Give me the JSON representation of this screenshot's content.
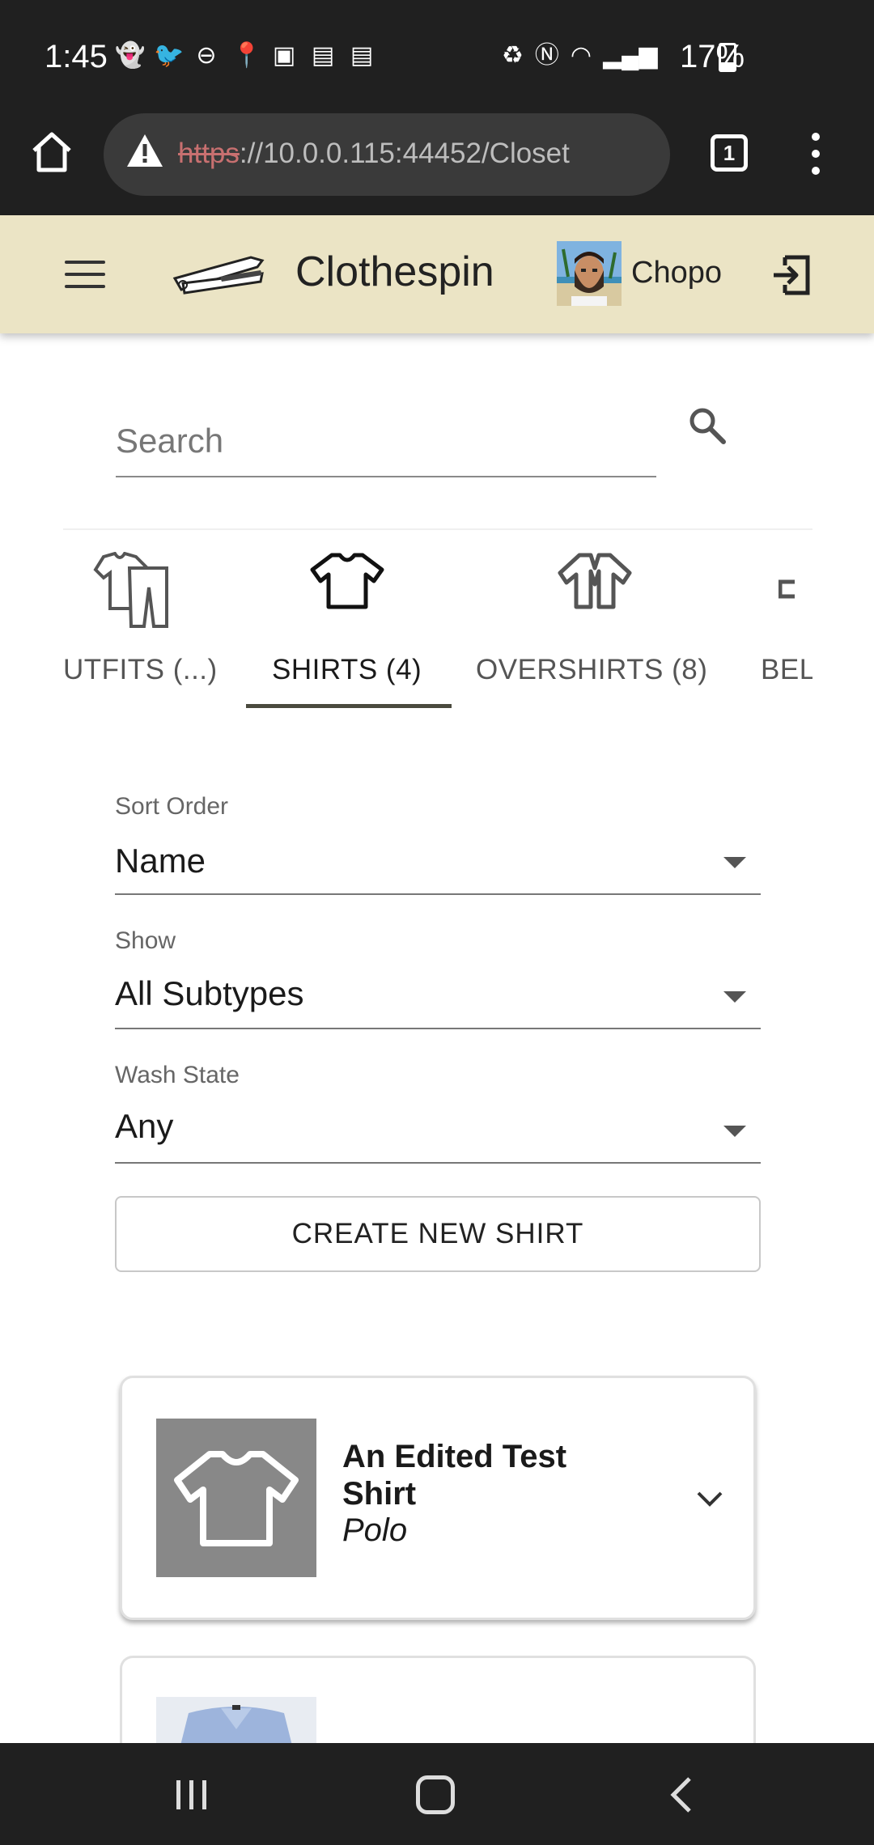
{
  "status_bar": {
    "time": "1:45",
    "battery_percent": "17%",
    "left_icons": [
      "snapchat-icon",
      "twitter-icon",
      "dnd-icon",
      "location-icon",
      "gallery-icon",
      "news-icon",
      "news-icon"
    ],
    "right_icons": [
      "battery-saver-icon",
      "nfc-icon",
      "wifi-icon",
      "signal-icon"
    ]
  },
  "browser": {
    "url_scheme": "https",
    "url_rest": "://10.0.0.115:44452/Closet",
    "tab_count": "1"
  },
  "app": {
    "brand": "Clothespin",
    "username": "Chopo",
    "header_bg": "#ebe4c5"
  },
  "search": {
    "placeholder": "Search"
  },
  "tabs": [
    {
      "label": "UTFITS (...)",
      "icon": "outfits-icon",
      "active": false
    },
    {
      "label": "SHIRTS (4)",
      "icon": "shirt-icon",
      "active": true
    },
    {
      "label": "OVERSHIRTS (8)",
      "icon": "overshirt-icon",
      "active": false
    },
    {
      "label": "BEL",
      "icon": "belt-icon",
      "active": false
    }
  ],
  "filters": {
    "sort_order": {
      "label": "Sort Order",
      "value": "Name"
    },
    "show": {
      "label": "Show",
      "value": "All Subtypes"
    },
    "wash_state": {
      "label": "Wash State",
      "value": "Any"
    }
  },
  "create_button": "CREATE NEW SHIRT",
  "cards": [
    {
      "title": "An Edited Test Shirt",
      "subtitle": "Polo",
      "image": "shirt-placeholder"
    },
    {
      "title": "",
      "subtitle": "",
      "image": "blue-dress-shirt"
    }
  ]
}
